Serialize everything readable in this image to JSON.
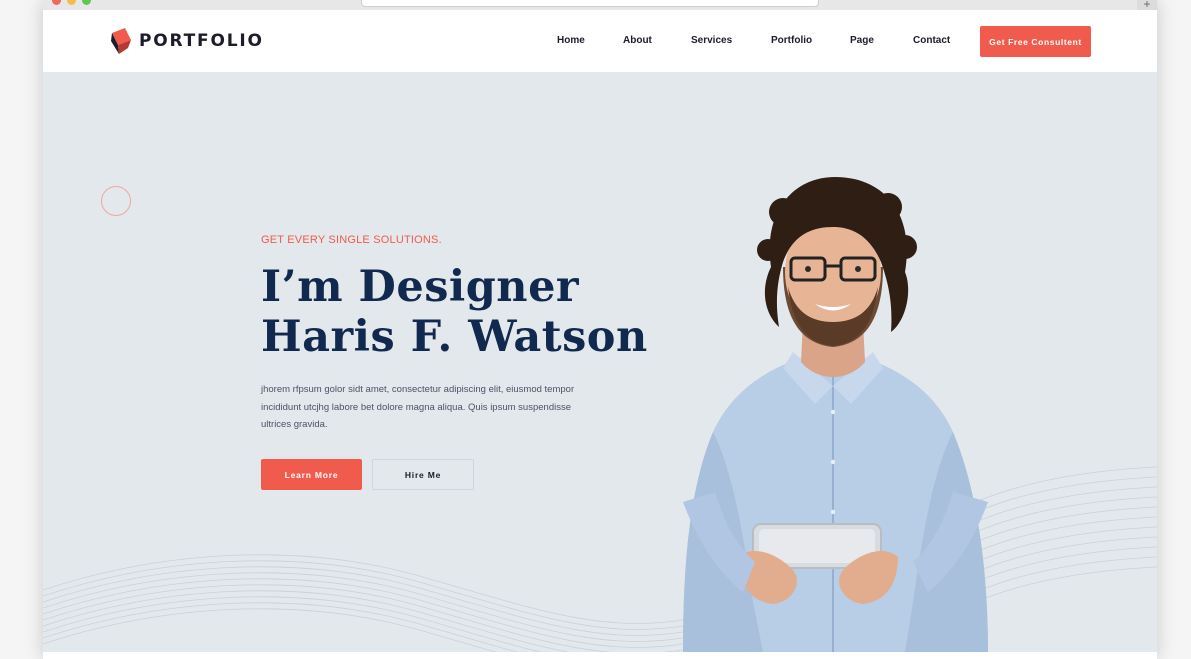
{
  "site": {
    "logo_text": "PORTFOLIO",
    "nav": [
      "Home",
      "About",
      "Services",
      "Portfolio",
      "Page",
      "Contact"
    ],
    "cta_label": "Get Free Consultent"
  },
  "hero": {
    "tagline": "GET EVERY SINGLE SOLUTIONS.",
    "heading_line1": "I’m Designer",
    "heading_line2": "Haris F. Watson",
    "description": "jhorem rfpsum golor sidt amet, consectetur adipiscing elit, eiusmod tempor incididunt utcjhg labore bet dolore magna aliqua. Quis ipsum suspendisse ultrices gravida.",
    "learn_more_label": "Learn More",
    "hire_me_label": "Hire Me"
  },
  "colors": {
    "accent": "#f15b4d",
    "heading": "#12294f",
    "hero_bg": "#e3e8ed"
  },
  "icons": [
    "logo-cube-icon",
    "reload-icon",
    "plus-icon"
  ]
}
